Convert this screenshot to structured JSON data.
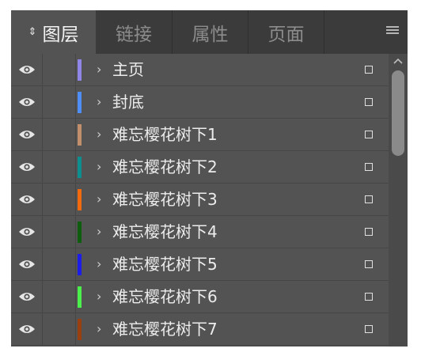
{
  "tabs": [
    {
      "label": "图层",
      "active": true
    },
    {
      "label": "链接",
      "active": false
    },
    {
      "label": "属性",
      "active": false
    },
    {
      "label": "页面",
      "active": false
    }
  ],
  "tab_icon": "updown-arrows-icon",
  "menu_icon": "panel-menu-icon",
  "layers": [
    {
      "name": "主页",
      "color": "#8f86e8"
    },
    {
      "name": "封底",
      "color": "#4f8ef7"
    },
    {
      "name": "难忘樱花树下1",
      "color": "#c28f6c"
    },
    {
      "name": "难忘樱花树下2",
      "color": "#0d8f8f"
    },
    {
      "name": "难忘樱花树下3",
      "color": "#f26a0d"
    },
    {
      "name": "难忘樱花树下4",
      "color": "#0f5e0f"
    },
    {
      "name": "难忘樱花树下5",
      "color": "#1d1dea"
    },
    {
      "name": "难忘樱花树下6",
      "color": "#4cf04c"
    },
    {
      "name": "难忘樱花树下7",
      "color": "#9a3f10"
    }
  ],
  "row_icons": {
    "visibility": "eye-icon",
    "expand": "chevron-right-icon",
    "select": "selection-square-icon"
  },
  "scroll": {
    "thumb_fraction": 0.3,
    "position": 0
  }
}
